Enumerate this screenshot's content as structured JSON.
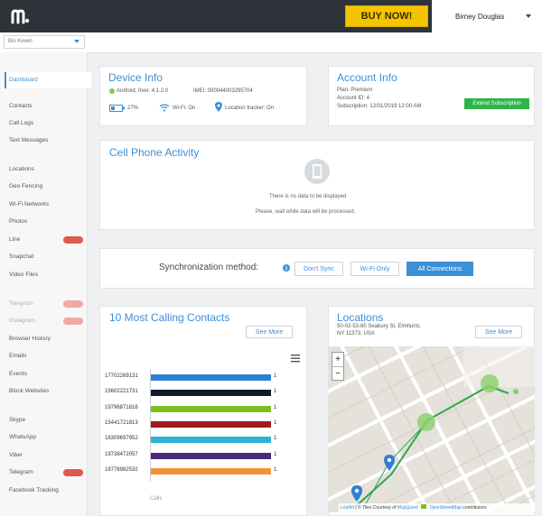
{
  "header": {
    "buy_label": "BUY NOW!",
    "user_name": "Birney Douglas"
  },
  "device_select": {
    "value": "Bin Kewin"
  },
  "sidebar": {
    "items": [
      {
        "label": "Dashboard",
        "state": "active"
      },
      {
        "label": "Contacts"
      },
      {
        "label": "Call Logs"
      },
      {
        "label": "Text Messages"
      },
      {
        "label": "Locations"
      },
      {
        "label": "Geo Fencing"
      },
      {
        "label": "Wi-Fi Networks"
      },
      {
        "label": "Photos"
      },
      {
        "label": "Line",
        "tag": "new"
      },
      {
        "label": "Snapchat"
      },
      {
        "label": "Video Files"
      },
      {
        "label": "Telegram",
        "dim": true,
        "tag": "light"
      },
      {
        "label": "Instagram",
        "dim": true,
        "tag": "light"
      },
      {
        "label": "Browser History"
      },
      {
        "label": "Emails"
      },
      {
        "label": "Events"
      },
      {
        "label": "Block Websites"
      },
      {
        "label": "Skype"
      },
      {
        "label": "WhatsApp"
      },
      {
        "label": "Viber"
      },
      {
        "label": "Telegram",
        "tag": "new"
      },
      {
        "label": "Facebook Tracking"
      }
    ]
  },
  "device_info": {
    "title": "Device Info",
    "os": "Android, 0ver. 4.1.2.0",
    "imei": "IMEI: 00094400329570​4",
    "battery_level": "27%",
    "wifi": "Wi-Fi: On",
    "location": "Location tracker: On"
  },
  "account_info": {
    "title": "Account Info",
    "plan": "Plan: Premium",
    "account_id": "Account ID: 4",
    "subscription": "Subscription: 12/01/2019 12:00 AM",
    "extend_label": "Extend Subscription"
  },
  "activity": {
    "title": "Cell Phone Activity",
    "empty_line1": "There is no data to be displayed",
    "empty_line2": "Please, wait while data will be processed."
  },
  "sync": {
    "label": "Synchronization method:",
    "options": [
      "Don't Sync",
      "Wi-Fi Only",
      "All Connections"
    ],
    "selected": "All Connections"
  },
  "contacts_card": {
    "title": "10 Most Calling Contacts",
    "see_more": "See More",
    "axis_label": "Calls"
  },
  "locations_card": {
    "title": "Locations",
    "address_line1": "50-02-53-80 Seabury St, Elmhurst,",
    "address_line2": "NY 11373, USA",
    "see_more": "See More",
    "zoom_in": "+",
    "zoom_out": "−",
    "attribution_leaflet": "Leaflet",
    "attribution_text": "| © Tiles Courtesy of",
    "attribution_mapquest": "MapQuest",
    "attribution_osm": "OpenStreetMap",
    "attribution_tail": "contributors"
  },
  "chart_data": {
    "type": "bar",
    "orientation": "horizontal",
    "categories": [
      "17702269131",
      "15602221731",
      "19796871816",
      "15441721813",
      "16309697952",
      "19738472057",
      "18776982532"
    ],
    "values": [
      1,
      1,
      1,
      1,
      1,
      1,
      1
    ],
    "colors": [
      "#2f7fd3",
      "#0d1b2a",
      "#7cbf1e",
      "#9e1b1b",
      "#2bb3d8",
      "#4a2a7a",
      "#f39237"
    ],
    "xlabel": "Calls",
    "xlim": [
      0,
      1
    ]
  }
}
